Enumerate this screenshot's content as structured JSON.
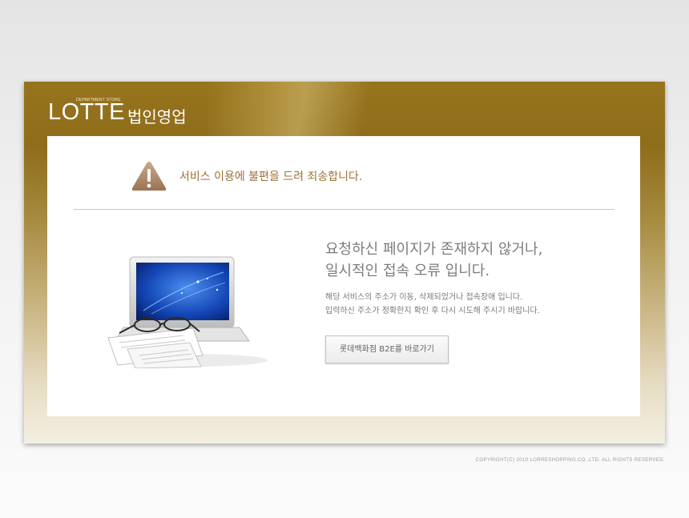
{
  "header": {
    "brand_sub": "DEPARTMENT STORE",
    "brand": "LOTTE",
    "brand_kor": "법인영업"
  },
  "notice": {
    "icon": "warning-icon",
    "title": "서비스 이용에 불편을 드려 죄송합니다."
  },
  "message": {
    "line1": "요청하신 페이지가 존재하지 않거나,",
    "line2": "일시적인 접속 오류 입니다.",
    "detail1": "해당 서비스의 주소가 이동, 삭제되었거나 접속장애 입니다.",
    "detail2": "입력하신 주소가 정확한지 확인 후 다시 시도해 주시기 바랍니다."
  },
  "illustration": {
    "icon": "laptop-with-glasses-icon"
  },
  "button": {
    "label": "롯데백화점 B2E를 바로가기"
  },
  "footer": {
    "copyright": "COPYRIGHT(C) 2010 LORRESHOPPING.CO.,LTD.  ALL RIGHTS RESERVED."
  },
  "colors": {
    "header_gold": "#97741c",
    "notice_text": "#9b7238",
    "message_text": "#7c7c7c"
  }
}
